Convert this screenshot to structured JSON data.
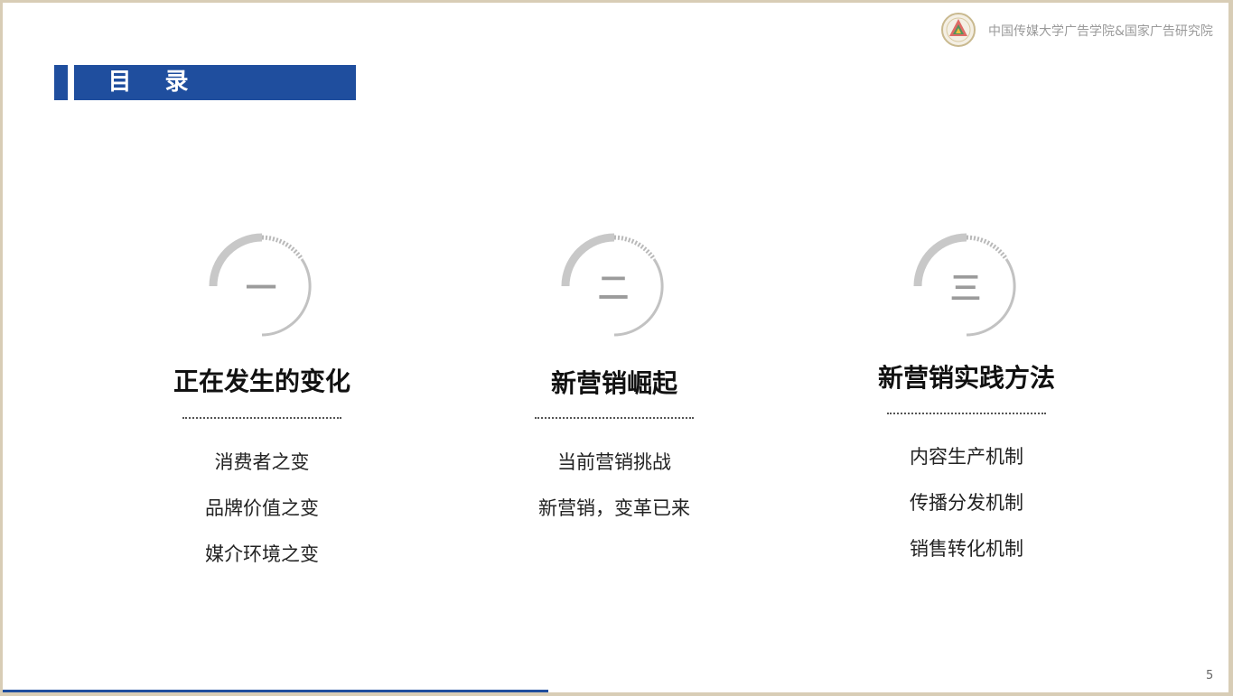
{
  "header": {
    "logo_icon": "university-emblem-icon",
    "org_name": "中国传媒大学广告学院&国家广告研究院"
  },
  "title": {
    "text": "目 录",
    "color": "#1f4e9e"
  },
  "sections": [
    {
      "numeral": "一",
      "title": "正在发生的变化",
      "items": [
        "消费者之变",
        "品牌价值之变",
        "媒介环境之变"
      ]
    },
    {
      "numeral": "二",
      "title": "新营销崛起",
      "items": [
        "当前营销挑战",
        "新营销，变革已来"
      ]
    },
    {
      "numeral": "三",
      "title": "新营销实践方法",
      "items": [
        "内容生产机制",
        "传播分发机制",
        "销售转化机制"
      ]
    }
  ],
  "footer": {
    "page_number": "5"
  }
}
